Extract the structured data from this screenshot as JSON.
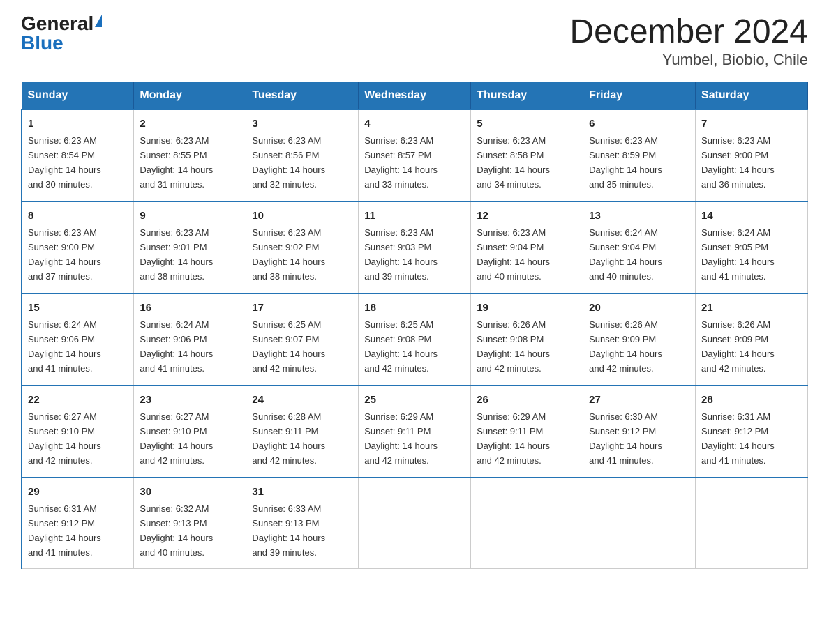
{
  "header": {
    "logo_general": "General",
    "logo_blue": "Blue",
    "title": "December 2024",
    "subtitle": "Yumbel, Biobio, Chile"
  },
  "days_of_week": [
    "Sunday",
    "Monday",
    "Tuesday",
    "Wednesday",
    "Thursday",
    "Friday",
    "Saturday"
  ],
  "weeks": [
    [
      {
        "day": "1",
        "sunrise": "6:23 AM",
        "sunset": "8:54 PM",
        "daylight": "14 hours and 30 minutes."
      },
      {
        "day": "2",
        "sunrise": "6:23 AM",
        "sunset": "8:55 PM",
        "daylight": "14 hours and 31 minutes."
      },
      {
        "day": "3",
        "sunrise": "6:23 AM",
        "sunset": "8:56 PM",
        "daylight": "14 hours and 32 minutes."
      },
      {
        "day": "4",
        "sunrise": "6:23 AM",
        "sunset": "8:57 PM",
        "daylight": "14 hours and 33 minutes."
      },
      {
        "day": "5",
        "sunrise": "6:23 AM",
        "sunset": "8:58 PM",
        "daylight": "14 hours and 34 minutes."
      },
      {
        "day": "6",
        "sunrise": "6:23 AM",
        "sunset": "8:59 PM",
        "daylight": "14 hours and 35 minutes."
      },
      {
        "day": "7",
        "sunrise": "6:23 AM",
        "sunset": "9:00 PM",
        "daylight": "14 hours and 36 minutes."
      }
    ],
    [
      {
        "day": "8",
        "sunrise": "6:23 AM",
        "sunset": "9:00 PM",
        "daylight": "14 hours and 37 minutes."
      },
      {
        "day": "9",
        "sunrise": "6:23 AM",
        "sunset": "9:01 PM",
        "daylight": "14 hours and 38 minutes."
      },
      {
        "day": "10",
        "sunrise": "6:23 AM",
        "sunset": "9:02 PM",
        "daylight": "14 hours and 38 minutes."
      },
      {
        "day": "11",
        "sunrise": "6:23 AM",
        "sunset": "9:03 PM",
        "daylight": "14 hours and 39 minutes."
      },
      {
        "day": "12",
        "sunrise": "6:23 AM",
        "sunset": "9:04 PM",
        "daylight": "14 hours and 40 minutes."
      },
      {
        "day": "13",
        "sunrise": "6:24 AM",
        "sunset": "9:04 PM",
        "daylight": "14 hours and 40 minutes."
      },
      {
        "day": "14",
        "sunrise": "6:24 AM",
        "sunset": "9:05 PM",
        "daylight": "14 hours and 41 minutes."
      }
    ],
    [
      {
        "day": "15",
        "sunrise": "6:24 AM",
        "sunset": "9:06 PM",
        "daylight": "14 hours and 41 minutes."
      },
      {
        "day": "16",
        "sunrise": "6:24 AM",
        "sunset": "9:06 PM",
        "daylight": "14 hours and 41 minutes."
      },
      {
        "day": "17",
        "sunrise": "6:25 AM",
        "sunset": "9:07 PM",
        "daylight": "14 hours and 42 minutes."
      },
      {
        "day": "18",
        "sunrise": "6:25 AM",
        "sunset": "9:08 PM",
        "daylight": "14 hours and 42 minutes."
      },
      {
        "day": "19",
        "sunrise": "6:26 AM",
        "sunset": "9:08 PM",
        "daylight": "14 hours and 42 minutes."
      },
      {
        "day": "20",
        "sunrise": "6:26 AM",
        "sunset": "9:09 PM",
        "daylight": "14 hours and 42 minutes."
      },
      {
        "day": "21",
        "sunrise": "6:26 AM",
        "sunset": "9:09 PM",
        "daylight": "14 hours and 42 minutes."
      }
    ],
    [
      {
        "day": "22",
        "sunrise": "6:27 AM",
        "sunset": "9:10 PM",
        "daylight": "14 hours and 42 minutes."
      },
      {
        "day": "23",
        "sunrise": "6:27 AM",
        "sunset": "9:10 PM",
        "daylight": "14 hours and 42 minutes."
      },
      {
        "day": "24",
        "sunrise": "6:28 AM",
        "sunset": "9:11 PM",
        "daylight": "14 hours and 42 minutes."
      },
      {
        "day": "25",
        "sunrise": "6:29 AM",
        "sunset": "9:11 PM",
        "daylight": "14 hours and 42 minutes."
      },
      {
        "day": "26",
        "sunrise": "6:29 AM",
        "sunset": "9:11 PM",
        "daylight": "14 hours and 42 minutes."
      },
      {
        "day": "27",
        "sunrise": "6:30 AM",
        "sunset": "9:12 PM",
        "daylight": "14 hours and 41 minutes."
      },
      {
        "day": "28",
        "sunrise": "6:31 AM",
        "sunset": "9:12 PM",
        "daylight": "14 hours and 41 minutes."
      }
    ],
    [
      {
        "day": "29",
        "sunrise": "6:31 AM",
        "sunset": "9:12 PM",
        "daylight": "14 hours and 41 minutes."
      },
      {
        "day": "30",
        "sunrise": "6:32 AM",
        "sunset": "9:13 PM",
        "daylight": "14 hours and 40 minutes."
      },
      {
        "day": "31",
        "sunrise": "6:33 AM",
        "sunset": "9:13 PM",
        "daylight": "14 hours and 39 minutes."
      },
      null,
      null,
      null,
      null
    ]
  ],
  "labels": {
    "sunrise": "Sunrise:",
    "sunset": "Sunset:",
    "daylight": "Daylight:"
  }
}
